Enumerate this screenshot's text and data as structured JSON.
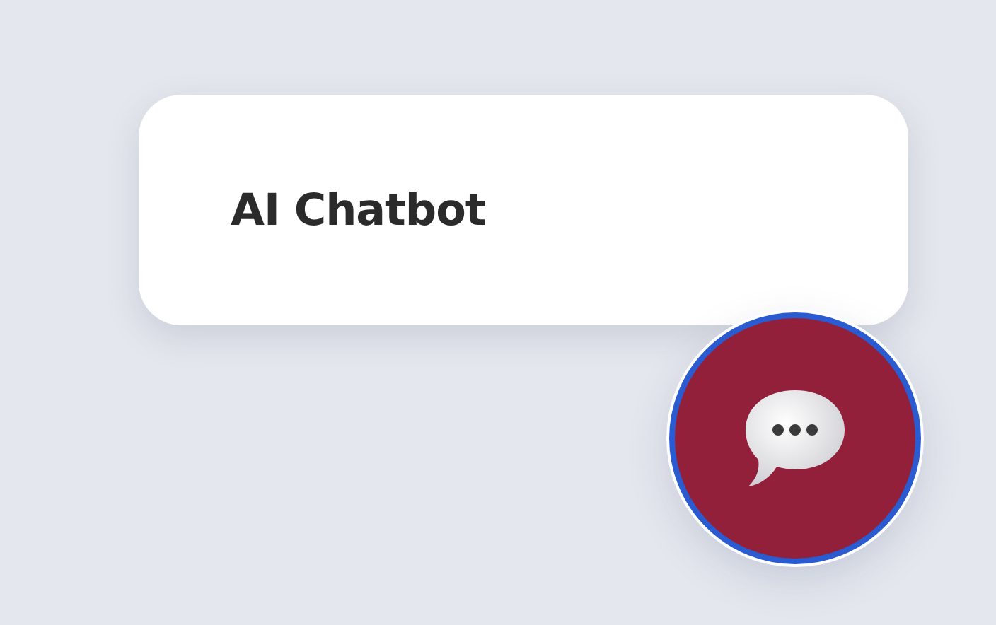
{
  "card": {
    "title": "AI Chatbot"
  }
}
